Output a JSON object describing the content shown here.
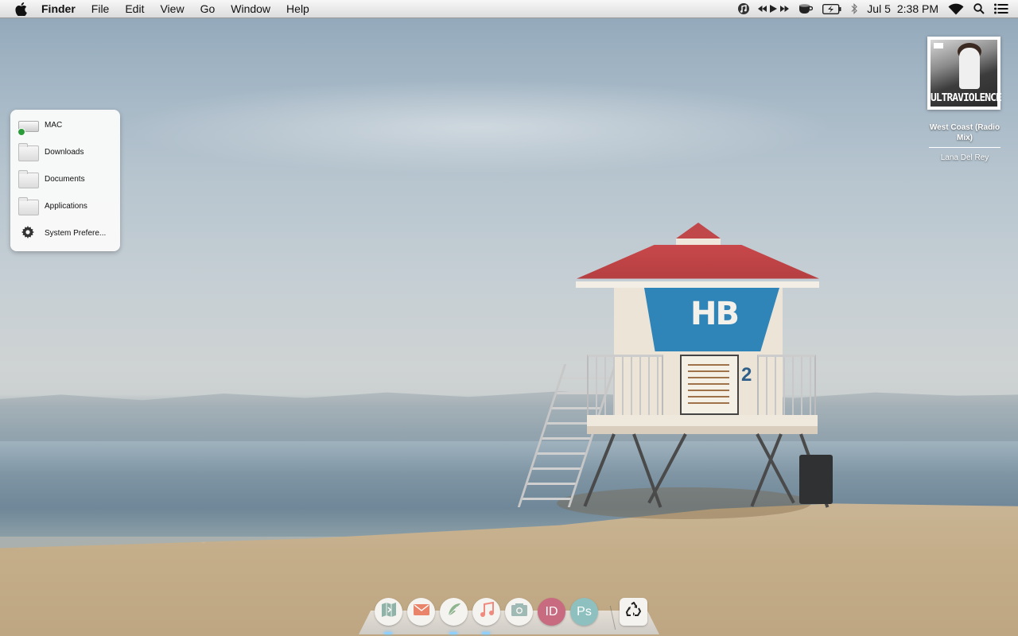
{
  "menubar": {
    "apple_icon": "apple-logo-icon",
    "app_name": "Finder",
    "menus": [
      "File",
      "Edit",
      "View",
      "Go",
      "Window",
      "Help"
    ],
    "status": {
      "date": "Jul 5",
      "time": "2:38 PM",
      "icons": [
        "music-note-icon",
        "rewind-icon",
        "play-icon",
        "fast-forward-icon",
        "coffee-cup-icon",
        "battery-charging-icon",
        "bluetooth-icon",
        "wifi-icon",
        "spotlight-search-icon",
        "notification-center-icon"
      ]
    }
  },
  "places": {
    "items": [
      {
        "label": "MAC",
        "icon": "hard-drive-icon"
      },
      {
        "label": "Downloads",
        "icon": "folder-icon"
      },
      {
        "label": "Documents",
        "icon": "folder-icon"
      },
      {
        "label": "Applications",
        "icon": "folder-icon"
      },
      {
        "label": "System Prefere...",
        "icon": "gear-icon"
      }
    ]
  },
  "now_playing": {
    "album_title": "ULTRAVIOLENCE",
    "track": "West Coast (Radio Mix)",
    "artist": "Lana Del Rey"
  },
  "desktop_art": {
    "tower_logo": "HB",
    "tower_number": "2"
  },
  "dock": {
    "items": [
      {
        "name": "maps",
        "icon": "map-icon",
        "color": "#8fb3a8"
      },
      {
        "name": "mail",
        "icon": "mail-icon",
        "color": "#e9846a"
      },
      {
        "name": "feather",
        "icon": "feather-icon",
        "color": "#8fb58f"
      },
      {
        "name": "music",
        "icon": "music-note-icon",
        "color": "#f08a7e"
      },
      {
        "name": "photo-booth",
        "icon": "camera-icon",
        "color": "#9fb9b5"
      },
      {
        "name": "indesign",
        "icon": "indesign-icon",
        "label": "ID",
        "color": "#c86a80"
      },
      {
        "name": "photoshop",
        "icon": "photoshop-icon",
        "label": "Ps",
        "color": "#8fc0c0"
      },
      {
        "name": "trash",
        "icon": "recycle-icon",
        "color": "#222222"
      }
    ]
  }
}
